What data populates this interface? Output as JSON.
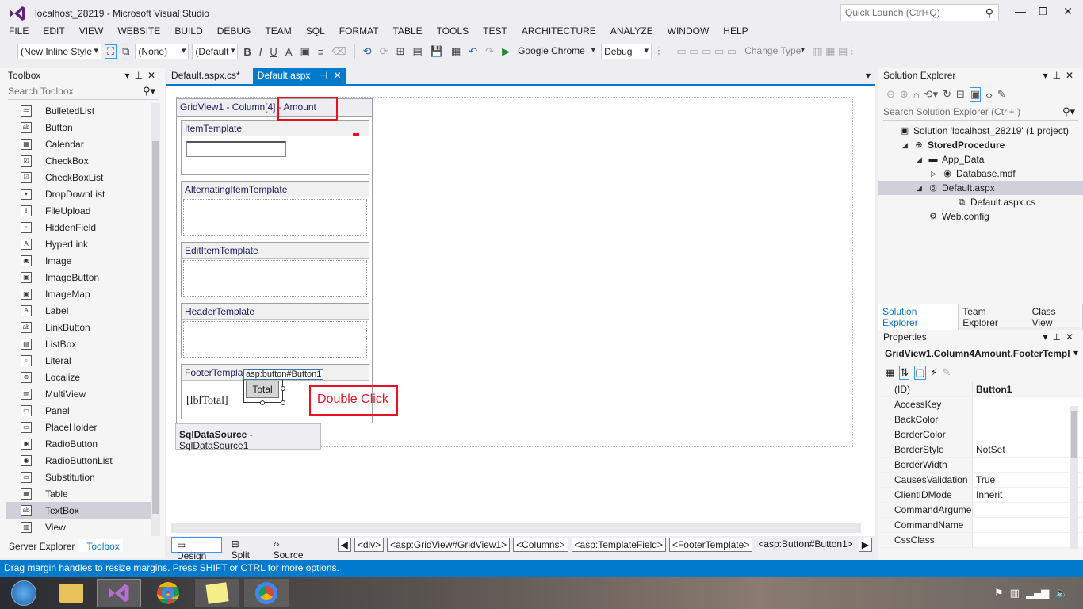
{
  "window": {
    "title": "localhost_28219 - Microsoft Visual Studio",
    "quick_launch_placeholder": "Quick Launch (Ctrl+Q)",
    "min": "—",
    "max": "⧠",
    "close": "✕"
  },
  "menu": [
    "FILE",
    "EDIT",
    "VIEW",
    "WEBSITE",
    "BUILD",
    "DEBUG",
    "TEAM",
    "SQL",
    "FORMAT",
    "TABLE",
    "TOOLS",
    "TEST",
    "ARCHITECTURE",
    "ANALYZE",
    "WINDOW",
    "HELP"
  ],
  "toolbar": {
    "style_combo": "(New Inline Style",
    "target_combo": "(None)",
    "font_combo": "(Default",
    "bold": "B",
    "italic": "I",
    "underline": "U",
    "run_label": "Google Chrome",
    "config_combo": "Debug",
    "change_type": "Change Type"
  },
  "toolbox": {
    "title": "Toolbox",
    "search_placeholder": "Search Toolbox",
    "items": [
      "BulletedList",
      "Button",
      "Calendar",
      "CheckBox",
      "CheckBoxList",
      "DropDownList",
      "FileUpload",
      "HiddenField",
      "HyperLink",
      "Image",
      "ImageButton",
      "ImageMap",
      "Label",
      "LinkButton",
      "ListBox",
      "Literal",
      "Localize",
      "MultiView",
      "Panel",
      "PlaceHolder",
      "RadioButton",
      "RadioButtonList",
      "Substitution",
      "Table",
      "TextBox",
      "View"
    ],
    "selected": "TextBox",
    "tabs": [
      "Server Explorer",
      "Toolbox"
    ]
  },
  "doc_tabs": [
    {
      "label": "Default.aspx.cs*"
    },
    {
      "label": "Default.aspx"
    }
  ],
  "designer": {
    "grid_header_prefix": "GridView1 - Column[4] -",
    "grid_header_field": "Amount",
    "templates": [
      "ItemTemplate",
      "AlternatingItemTemplate",
      "EditItemTemplate",
      "HeaderTemplate",
      "FooterTemplate"
    ],
    "footer_label": "[lblTotal]",
    "button_tag": "asp:button#Button1",
    "button_text": "Total",
    "annotation": "Double Click",
    "sqlds_bold": "SqlDataSource",
    "sqlds_rest": " - SqlDataSource1"
  },
  "view_buttons": [
    "Design",
    "Split",
    "Source"
  ],
  "breadcrumbs": [
    "<div>",
    "<asp:GridView#GridView1>",
    "<Columns>",
    "<asp:TemplateField>",
    "<FooterTemplate>",
    "<asp:Button#Button1>"
  ],
  "solution_explorer": {
    "title": "Solution Explorer",
    "search_placeholder": "Search Solution Explorer (Ctrl+;)",
    "tree": [
      {
        "label": "Solution 'localhost_28219' (1 project)",
        "indent": 0,
        "arrow": "",
        "bold": false
      },
      {
        "label": "StoredProcedure",
        "indent": 1,
        "arrow": "◢",
        "bold": true
      },
      {
        "label": "App_Data",
        "indent": 2,
        "arrow": "◢",
        "bold": false
      },
      {
        "label": "Database.mdf",
        "indent": 3,
        "arrow": "▷",
        "bold": false
      },
      {
        "label": "Default.aspx",
        "indent": 2,
        "arrow": "◢",
        "bold": false
      },
      {
        "label": "Default.aspx.cs",
        "indent": 4,
        "arrow": "",
        "bold": false
      },
      {
        "label": "Web.config",
        "indent": 2,
        "arrow": "",
        "bold": false
      }
    ],
    "tabs": [
      "Solution Explorer",
      "Team Explorer",
      "Class View"
    ]
  },
  "properties": {
    "title": "Properties",
    "object": "GridView1.Column4Amount.FooterTempl",
    "rows": [
      {
        "name": "(ID)",
        "value": "Button1"
      },
      {
        "name": "AccessKey",
        "value": ""
      },
      {
        "name": "BackColor",
        "value": ""
      },
      {
        "name": "BorderColor",
        "value": ""
      },
      {
        "name": "BorderStyle",
        "value": "NotSet"
      },
      {
        "name": "BorderWidth",
        "value": ""
      },
      {
        "name": "CausesValidation",
        "value": "True"
      },
      {
        "name": "ClientIDMode",
        "value": "Inherit"
      },
      {
        "name": "CommandArgume",
        "value": ""
      },
      {
        "name": "CommandName",
        "value": ""
      },
      {
        "name": "CssClass",
        "value": ""
      }
    ]
  },
  "status": "Drag margin handles to resize margins. Press SHIFT or CTRL for more options.",
  "colors": {
    "accent": "#007ACC",
    "annotation": "#E81123"
  }
}
